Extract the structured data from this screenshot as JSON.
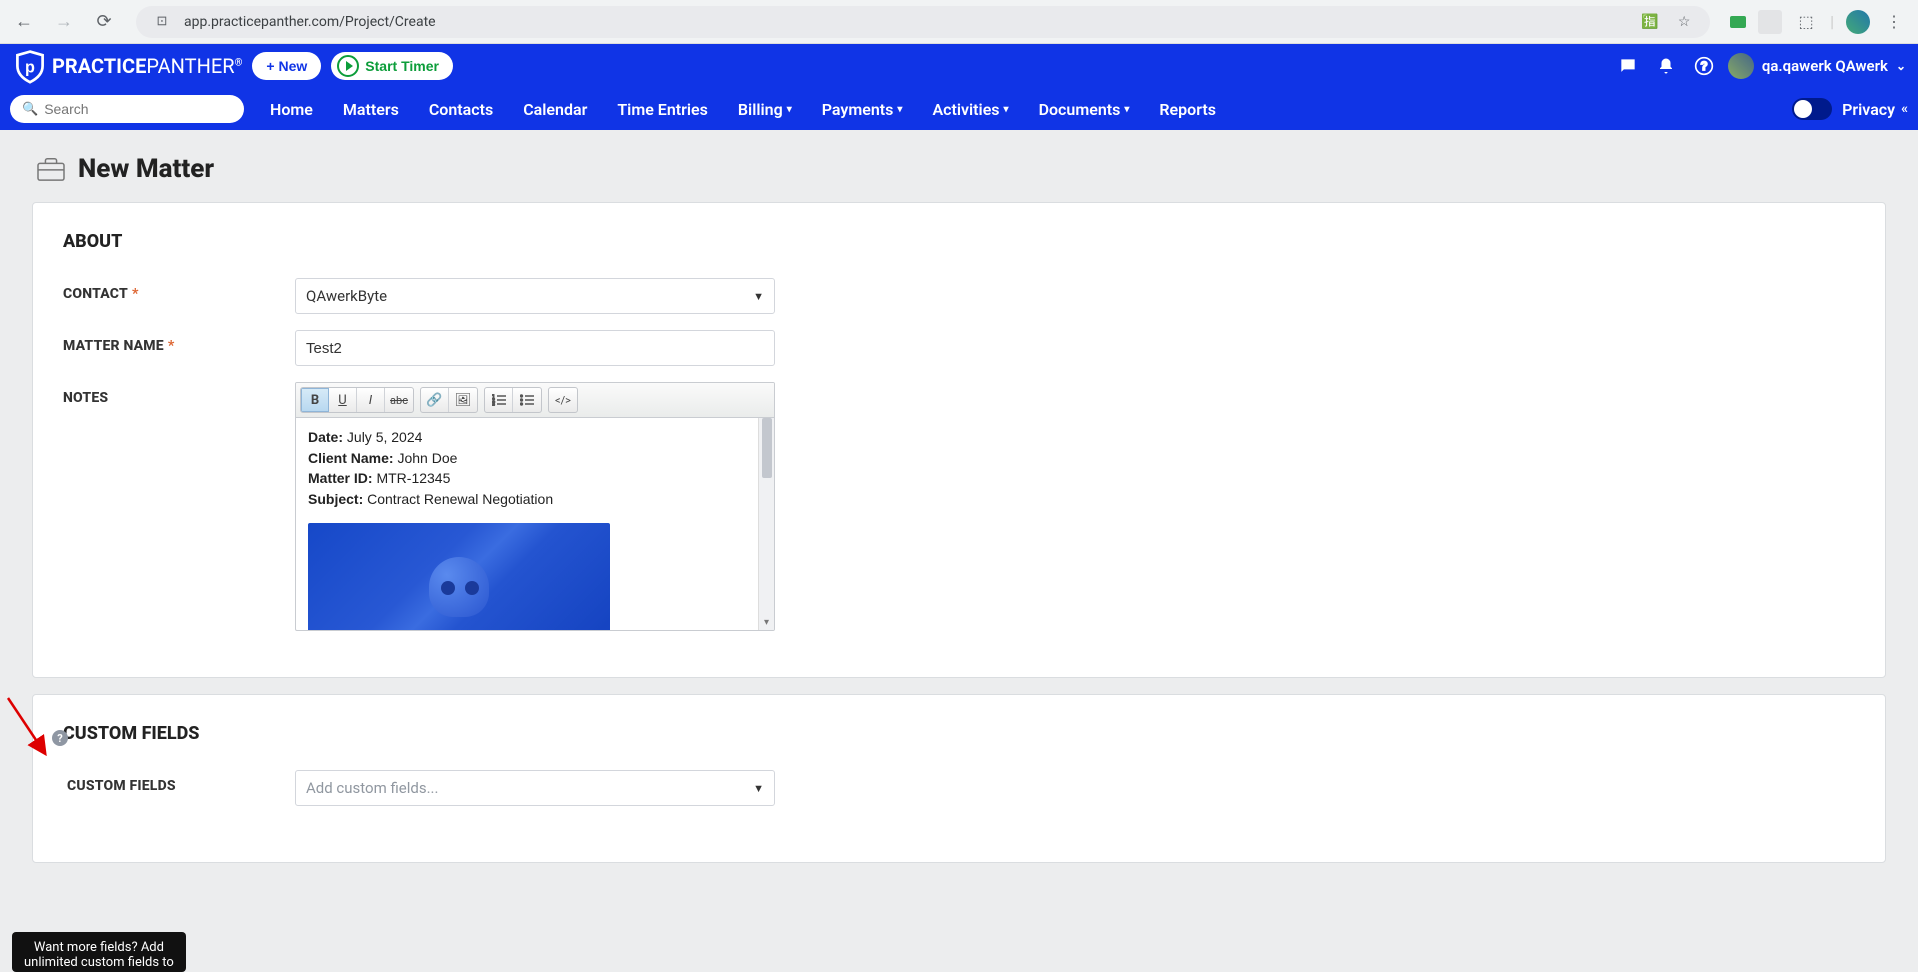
{
  "browser": {
    "url": "app.practicepanther.com/Project/Create"
  },
  "header": {
    "brand_bold": "PRACTICE",
    "brand_light": "PANTHER",
    "new_btn": "+ New",
    "timer_btn": "Start Timer",
    "user_name": "qa.qawerk QAwerk"
  },
  "nav": {
    "search_placeholder": "Search",
    "items": [
      "Home",
      "Matters",
      "Contacts",
      "Calendar",
      "Time Entries",
      "Billing",
      "Payments",
      "Activities",
      "Documents",
      "Reports"
    ],
    "dropdowns": [
      false,
      false,
      false,
      false,
      false,
      true,
      true,
      true,
      true,
      false
    ],
    "privacy": "Privacy"
  },
  "page": {
    "title": "New Matter",
    "about": {
      "heading": "ABOUT",
      "contact_label": "CONTACT",
      "contact_value": "QAwerkByte",
      "matter_label": "MATTER NAME",
      "matter_value": "Test2",
      "notes_label": "NOTES",
      "notes": {
        "date_k": "Date:",
        "date_v": "July 5, 2024",
        "client_k": "Client Name:",
        "client_v": "John Doe",
        "matter_k": "Matter ID:",
        "matter_v": "MTR-12345",
        "subject_k": "Subject:",
        "subject_v": "Contract Renewal Negotiation"
      }
    },
    "custom": {
      "heading": "CUSTOM FIELDS",
      "field_label": "CUSTOM FIELDS",
      "placeholder": "Add custom fields..."
    }
  },
  "tooltip": {
    "line1": "Want more fields? Add",
    "line2": "unlimited custom fields to"
  }
}
